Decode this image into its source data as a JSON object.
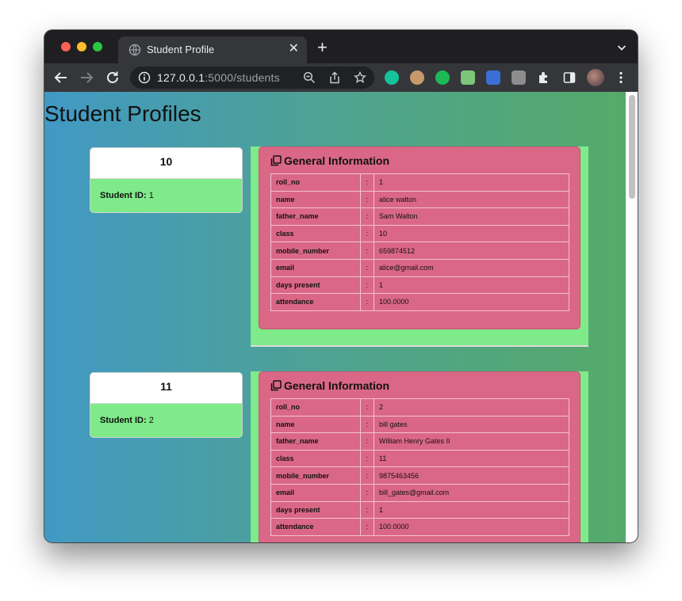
{
  "browser": {
    "tab_title": "Student Profile",
    "url_host": "127.0.0.1",
    "url_rest": ":5000/students"
  },
  "page": {
    "title": "Student Profiles"
  },
  "section_heading": "General Information",
  "students": [
    {
      "header": "10",
      "id_label": "Student ID:",
      "id_value": "1",
      "info": [
        [
          "roll_no",
          ":",
          "1"
        ],
        [
          "name",
          ":",
          "alice walton"
        ],
        [
          "father_name",
          ":",
          "Sam Walton"
        ],
        [
          "class",
          ":",
          "10"
        ],
        [
          "mobile_number",
          ":",
          "659874512"
        ],
        [
          "email",
          ":",
          "alice@gmail.com"
        ],
        [
          "days present",
          ":",
          "1"
        ],
        [
          "attendance",
          ":",
          "100.0000"
        ]
      ]
    },
    {
      "header": "11",
      "id_label": "Student ID:",
      "id_value": "2",
      "info": [
        [
          "roll_no",
          ":",
          "2"
        ],
        [
          "name",
          ":",
          "bill gates"
        ],
        [
          "father_name",
          ":",
          "William Henry Gates II"
        ],
        [
          "class",
          ":",
          "11"
        ],
        [
          "mobile_number",
          ":",
          "9875463456"
        ],
        [
          "email",
          ":",
          "bill_gates@gmail.com"
        ],
        [
          "days present",
          ":",
          "1"
        ],
        [
          "attendance",
          ":",
          "100.0000"
        ]
      ]
    }
  ],
  "colors": {
    "card_pink": "#db6786",
    "panel_green": "#7fea89",
    "gradient_start": "#4199c4",
    "gradient_end": "#55aa6a"
  }
}
